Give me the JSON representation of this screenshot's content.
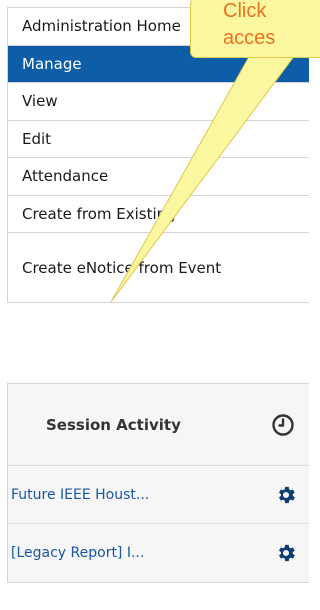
{
  "menu": {
    "items": [
      {
        "label": "Administration Home",
        "active": false
      },
      {
        "label": "Manage",
        "active": true
      },
      {
        "label": "View",
        "active": false
      },
      {
        "label": "Edit",
        "active": false
      },
      {
        "label": "Attendance",
        "active": false
      },
      {
        "label": "Create from Existing",
        "active": false
      },
      {
        "label": "Create eNotice from Event",
        "active": false
      }
    ]
  },
  "callout": {
    "line1": "Click",
    "line2": "acces"
  },
  "session_activity": {
    "title": "Session Activity",
    "header_icon": "clock-icon",
    "rows": [
      {
        "label": "Future IEEE Houst...",
        "icon": "gear-icon"
      },
      {
        "label": "[Legacy Report] I...",
        "icon": "gear-icon"
      }
    ]
  },
  "colors": {
    "active_bg": "#0d5ea6",
    "link": "#1a56a6",
    "callout_bg": "#fbf6a0",
    "callout_text": "#e8731f"
  }
}
